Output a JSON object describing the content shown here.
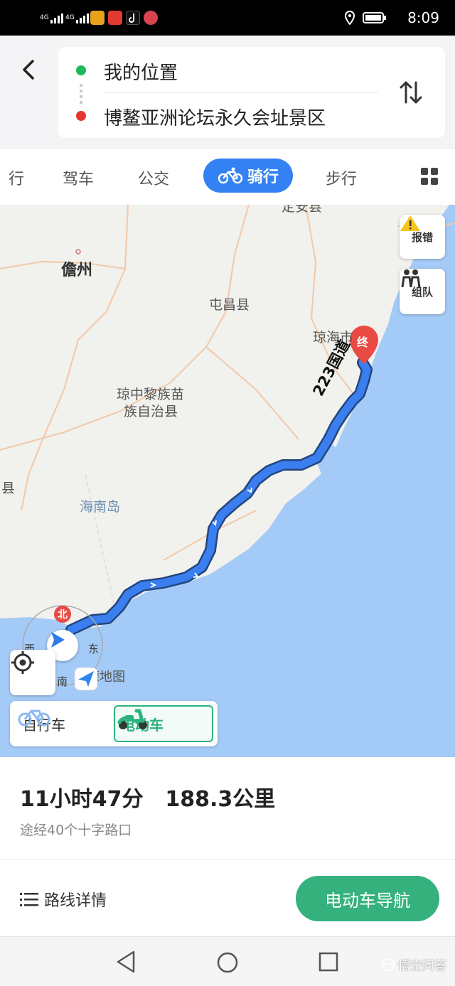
{
  "status_bar": {
    "network_1": "4G",
    "network_2": "4G",
    "time": "8:09",
    "icons": [
      "signal-icon",
      "signal-icon",
      "app-icon",
      "toutiao-icon",
      "tiktok-icon",
      "app-icon",
      "location-icon",
      "battery-icon"
    ]
  },
  "header": {
    "back_icon": "chevron-left-icon",
    "origin": "我的位置",
    "destination": "博鳌亚洲论坛永久会址景区",
    "origin_color": "#1fb85a",
    "destination_color": "#e8352f",
    "swap_icon": "swap-vertical-icon"
  },
  "tabs": {
    "items": [
      {
        "label": "行",
        "active": false
      },
      {
        "label": "驾车",
        "active": false
      },
      {
        "label": "公交",
        "active": false
      },
      {
        "label": "骑行",
        "active": true
      },
      {
        "label": "步行",
        "active": false
      }
    ],
    "accent": "#3481f3",
    "more_icon": "grid-icon"
  },
  "map": {
    "labels": {
      "top_partial": "定安县",
      "danzhou": "儋州",
      "tunchang": "屯昌县",
      "qionghai": "琼海市",
      "qiongzhong_1": "琼中黎族苗",
      "qiongzhong_2": "族自治县",
      "county_left": "县",
      "hainan_island": "海南岛",
      "road_name": "223国道",
      "end_marker": "终"
    },
    "buttons": {
      "report": "报错",
      "team": "组队"
    },
    "compass": {
      "north": "北",
      "west": "西",
      "east": "东",
      "south": "南"
    },
    "logo": "高德地图",
    "route_color": "#3a7ef0",
    "sea_color": "#a4cbf7",
    "vehicle_toggle": {
      "bicycle": "自行车",
      "ebike": "电动车",
      "active_color": "#2bb37d"
    }
  },
  "panel": {
    "duration": "11小时47分",
    "distance": "188.3公里",
    "via": "途经40个十字路口",
    "details": "路线详情",
    "nav_button": "电动车导航",
    "nav_color": "#35b17e"
  },
  "system_nav": {
    "watermark": "悟空问答"
  }
}
